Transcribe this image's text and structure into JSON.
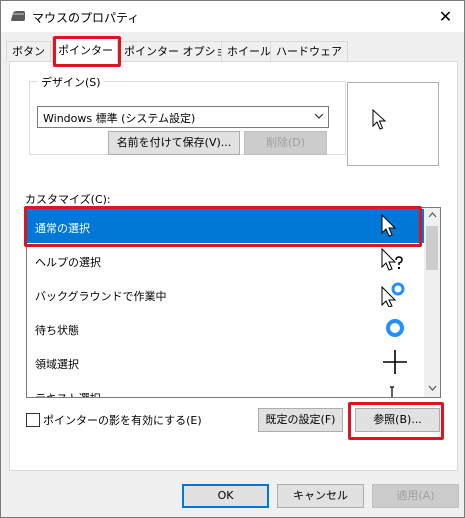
{
  "window": {
    "title": "マウスのプロパティ",
    "close_glyph": "✕"
  },
  "tabs": [
    {
      "label": "ボタン"
    },
    {
      "label": "ポインター"
    },
    {
      "label": "ポインター オプション"
    },
    {
      "label": "ホイール"
    },
    {
      "label": "ハードウェア"
    }
  ],
  "active_tab": "ポインター",
  "design": {
    "group_label": "デザイン(S)",
    "scheme_value": "Windows 標準 (システム設定)",
    "save_as_label": "名前を付けて保存(V)...",
    "delete_label": "削除(D)"
  },
  "customize": {
    "label": "カスタマイズ(C):",
    "items": [
      {
        "label": "通常の選択",
        "cursor": "arrow-cursor-icon",
        "selected": true
      },
      {
        "label": "ヘルプの選択",
        "cursor": "help-cursor-icon",
        "selected": false
      },
      {
        "label": "バックグラウンドで作業中",
        "cursor": "working-background-cursor-icon",
        "selected": false
      },
      {
        "label": "待ち状態",
        "cursor": "busy-cursor-icon",
        "selected": false
      },
      {
        "label": "領域選択",
        "cursor": "precision-cursor-icon",
        "selected": false
      },
      {
        "label": "テキスト選択",
        "cursor": "text-cursor-icon",
        "selected": false
      }
    ]
  },
  "shadow_checkbox": {
    "label": "ポインターの影を有効にする(E)",
    "checked": false
  },
  "default_button_label": "既定の設定(F)",
  "browse_button_label": "参照(B)...",
  "footer": {
    "ok_label": "OK",
    "cancel_label": "キャンセル",
    "apply_label": "適用(A)"
  },
  "colors": {
    "accent": "#0078d7",
    "highlight": "#e0141e",
    "spinner": "#1e90ff"
  }
}
